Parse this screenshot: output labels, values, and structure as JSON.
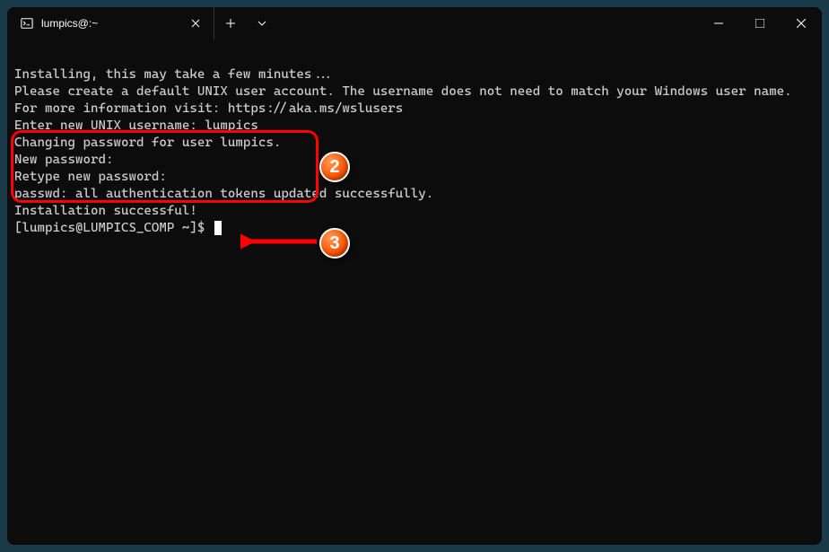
{
  "tab": {
    "title": "lumpics@:~"
  },
  "terminal": {
    "lines": [
      "Installing, this may take a few minutes...",
      "Please create a default UNIX user account. The username does not need to match your Windows user name.",
      "For more information visit: https://aka.ms/wslusers",
      "Enter new UNIX username: lumpics",
      "Changing password for user lumpics.",
      "New password:",
      "Retype new password:",
      "passwd: all authentication tokens updated successfully.",
      "Installation successful!",
      "[lumpics@LUMPICS_COMP ~]$ "
    ]
  },
  "callouts": {
    "c2": "2",
    "c3": "3"
  }
}
